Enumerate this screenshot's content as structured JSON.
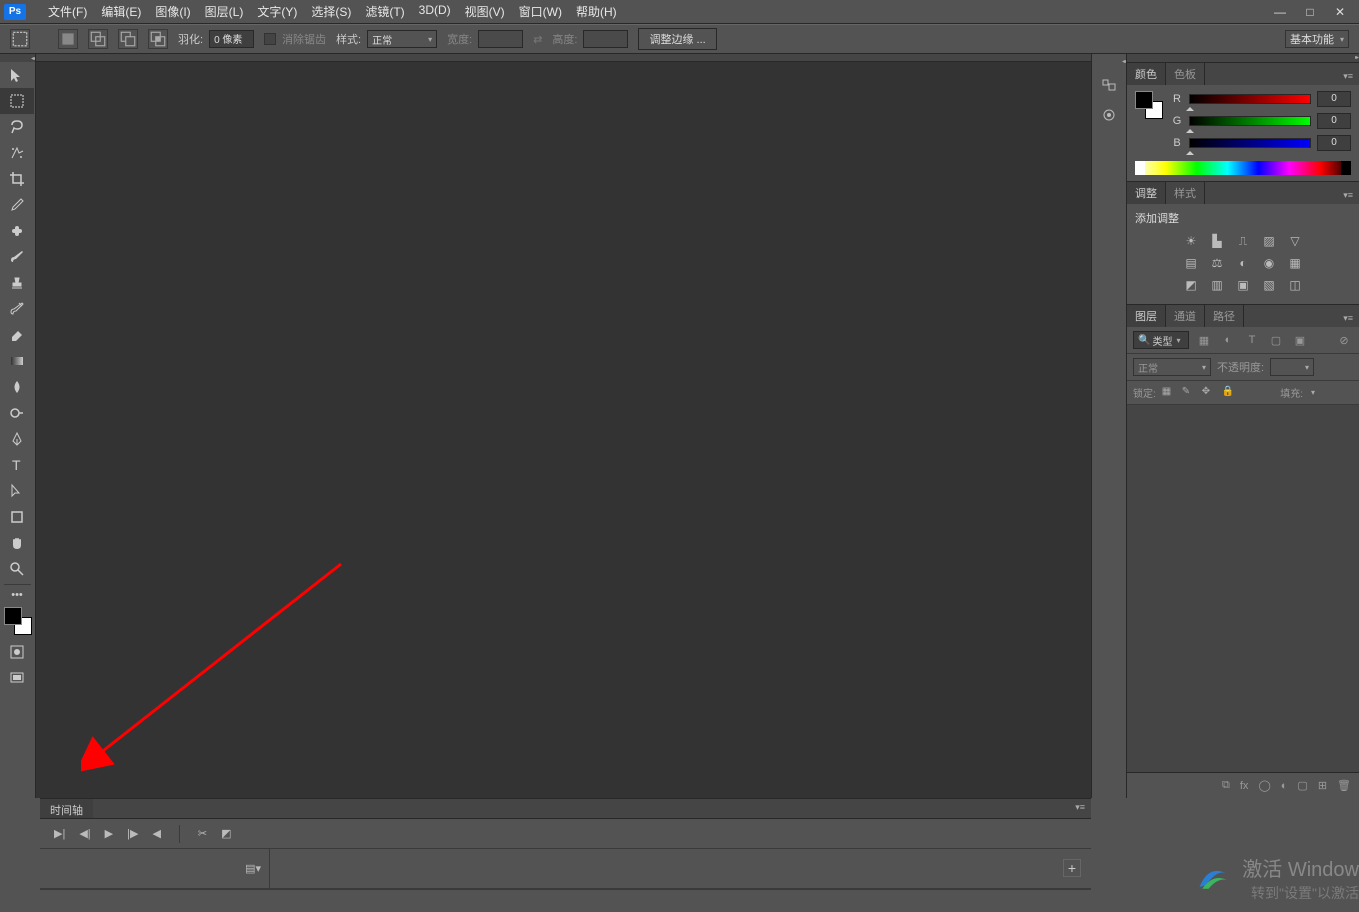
{
  "app": {
    "logo": "Ps"
  },
  "menu": [
    "文件(F)",
    "编辑(E)",
    "图像(I)",
    "图层(L)",
    "文字(Y)",
    "选择(S)",
    "滤镜(T)",
    "3D(D)",
    "视图(V)",
    "窗口(W)",
    "帮助(H)"
  ],
  "options": {
    "feather_label": "羽化:",
    "feather_value": "0 像素",
    "antialias": "消除锯齿",
    "style_label": "样式:",
    "style_value": "正常",
    "width_label": "宽度:",
    "height_label": "高度:",
    "refine": "调整边缘 ...",
    "workspace": "基本功能"
  },
  "tools": [
    "move",
    "marquee",
    "lasso",
    "wand",
    "crop",
    "eyedropper",
    "heal",
    "brush",
    "stamp",
    "history",
    "eraser",
    "gradient",
    "blur",
    "dodge",
    "pen",
    "type",
    "path-sel",
    "shape",
    "hand",
    "zoom"
  ],
  "panels": {
    "color": {
      "tab1": "颜色",
      "tab2": "色板",
      "r": "R",
      "g": "G",
      "b": "B",
      "val": "0"
    },
    "adjust": {
      "tab1": "调整",
      "tab2": "样式",
      "title": "添加调整"
    },
    "layers": {
      "tab1": "图层",
      "tab2": "通道",
      "tab3": "路径",
      "filter_label": "类型",
      "blend": "正常",
      "opacity_label": "不透明度:",
      "lock_label": "锁定:",
      "fill_label": "填充:"
    }
  },
  "timeline": {
    "tab": "时间轴"
  },
  "watermark": {
    "l1": "激活 Window",
    "l2": "转到\"设置\"以激活"
  }
}
